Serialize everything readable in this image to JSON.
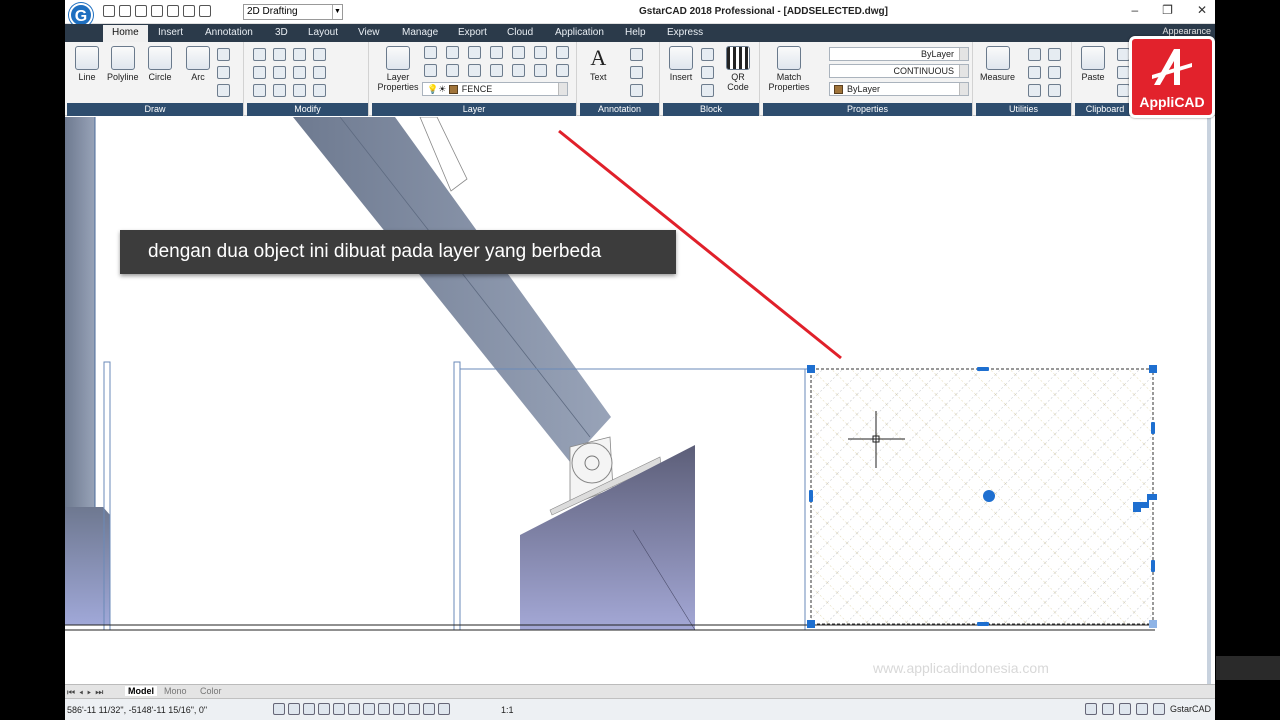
{
  "window": {
    "title": "GstarCAD 2018 Professional - [ADDSELECTED.dwg]",
    "workspace": "2D Drafting",
    "controls": [
      "–",
      "❐",
      "✕"
    ]
  },
  "menu_tabs": [
    "Home",
    "Insert",
    "Annotation",
    "3D",
    "Layout",
    "View",
    "Manage",
    "Export",
    "Cloud",
    "Application",
    "Help",
    "Express"
  ],
  "appearance_label": "Appearance",
  "ribbon": {
    "draw": {
      "label": "Draw",
      "buttons": [
        "Line",
        "Polyline",
        "Circle",
        "Arc"
      ]
    },
    "modify": {
      "label": "Modify"
    },
    "layer": {
      "label": "Layer",
      "button": "Layer Properties",
      "current_layer": "FENCE"
    },
    "annotation": {
      "label": "Annotation",
      "button": "Text"
    },
    "block": {
      "label": "Block",
      "buttons": [
        "Insert",
        "QR Code"
      ]
    },
    "properties": {
      "label": "Properties",
      "button": "Match Properties",
      "lineweight": "ByLayer",
      "linetype": "CONTINUOUS",
      "color": "ByLayer"
    },
    "utilities": {
      "label": "Utilities",
      "button": "Measure"
    },
    "clipboard": {
      "label": "Clipboard",
      "button": "Paste"
    }
  },
  "overlay": {
    "subtitle": "dengan dua object ini dibuat pada layer yang berbeda",
    "watermark": "www.applicadindonesia.com",
    "brand": "AppliCAD"
  },
  "layout_tabs": [
    "Model",
    "Mono",
    "Color"
  ],
  "status": {
    "coords": "586'-11 11/32\", -5148'-11 15/16\", 0\"",
    "scale": "1:1",
    "app_name": "GstarCAD"
  },
  "colors": {
    "tab_bar": "#2b3a4a",
    "panel_label": "#2e4d6e",
    "arrow": "#e0202a",
    "grip": "#1e6fd0",
    "brand_red": "#e2222c"
  }
}
